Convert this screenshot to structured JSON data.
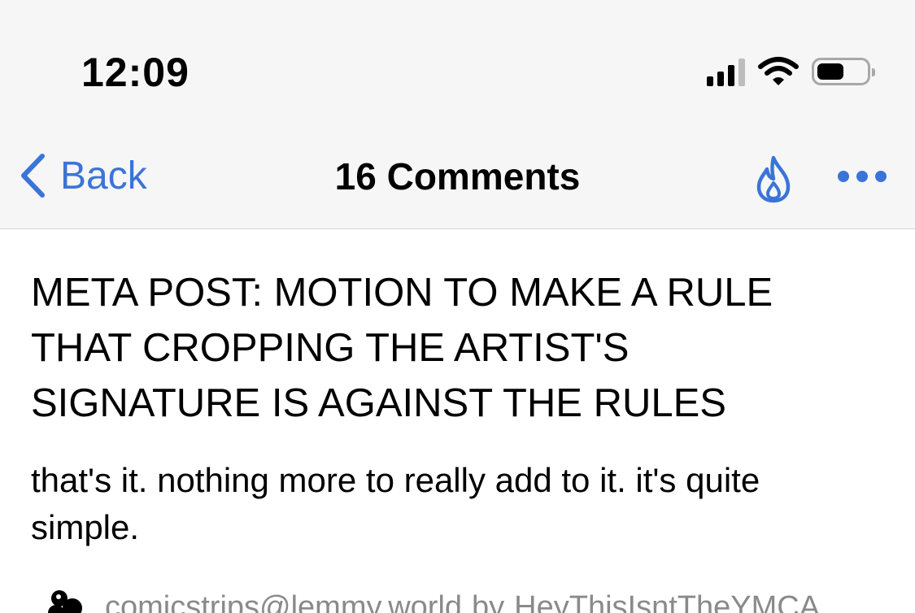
{
  "status_bar": {
    "time": "12:09",
    "battery_level": 0.55,
    "signal_bars_active": 3,
    "signal_bars_total": 4
  },
  "nav": {
    "back_label": "Back",
    "title": "16 Comments",
    "accent_color": "#3b74d8",
    "right_icons": [
      "flame-icon",
      "more-icon"
    ]
  },
  "post": {
    "title": "META POST: MOTION TO MAKE A RULE THAT CROPPING THE ARTIST'S SIGNATURE IS AGAINST THE RULES",
    "body": "that's it. nothing more to really add to it. it's quite simple.",
    "community": "comicstrips@lemmy.world",
    "by_label": "by",
    "author": "HeyThisIsntTheYMCA"
  }
}
